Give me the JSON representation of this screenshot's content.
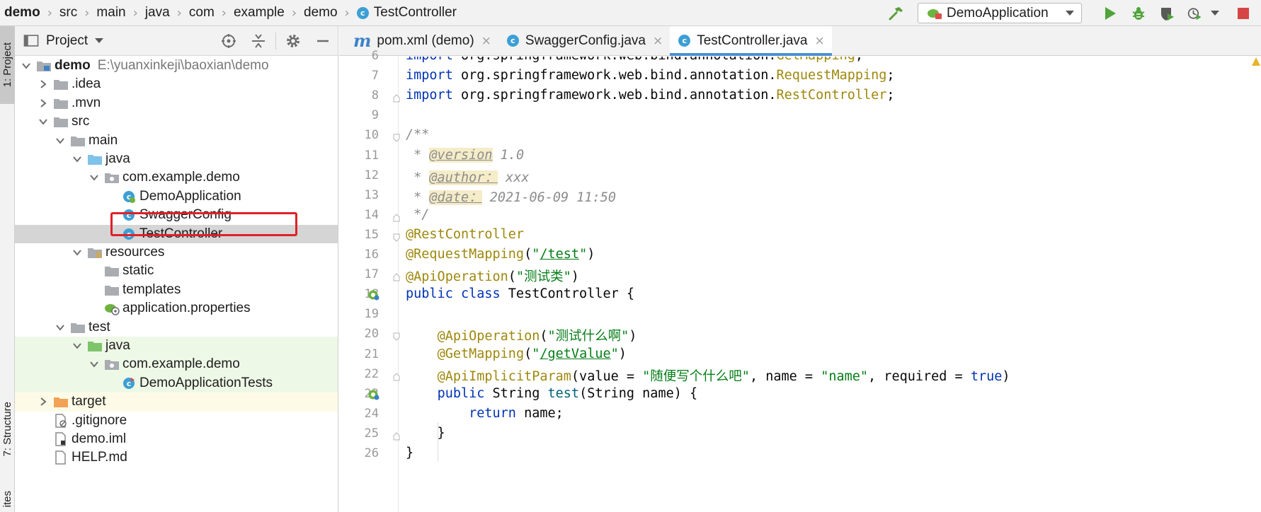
{
  "breadcrumb": [
    {
      "label": "demo",
      "bold": true
    },
    {
      "label": "src"
    },
    {
      "label": "main"
    },
    {
      "label": "java"
    },
    {
      "label": "com"
    },
    {
      "label": "example"
    },
    {
      "label": "demo"
    },
    {
      "label": "TestController",
      "class_icon": true
    }
  ],
  "toolbar": {
    "run_config": "DemoApplication",
    "icons": [
      "hammer-icon",
      "run-icon",
      "debug-icon",
      "coverage-icon",
      "profile-icon",
      "stop-icon"
    ]
  },
  "tool_strip": {
    "project_label": "1: Project",
    "structure_label": "7: Structure",
    "favorites_label": "ites"
  },
  "project_panel": {
    "title": "Project",
    "tree": [
      {
        "label": "demo",
        "path": "E:\\yuanxinkeji\\baoxian\\demo",
        "depth": 0,
        "chev": "down",
        "icon": "module"
      },
      {
        "label": ".idea",
        "depth": 1,
        "chev": "right",
        "icon": "folder"
      },
      {
        "label": ".mvn",
        "depth": 1,
        "chev": "right",
        "icon": "folder"
      },
      {
        "label": "src",
        "depth": 1,
        "chev": "down",
        "icon": "folder"
      },
      {
        "label": "main",
        "depth": 2,
        "chev": "down",
        "icon": "folder"
      },
      {
        "label": "java",
        "depth": 3,
        "chev": "down",
        "icon": "source-folder"
      },
      {
        "label": "com.example.demo",
        "depth": 4,
        "chev": "down",
        "icon": "package"
      },
      {
        "label": "DemoApplication",
        "depth": 5,
        "icon": "spring-class"
      },
      {
        "label": "SwaggerConfig",
        "depth": 5,
        "icon": "class"
      },
      {
        "label": "TestController",
        "depth": 5,
        "icon": "class",
        "selected": true
      },
      {
        "label": "resources",
        "depth": 3,
        "chev": "down",
        "icon": "resources-folder"
      },
      {
        "label": "static",
        "depth": 4,
        "icon": "folder"
      },
      {
        "label": "templates",
        "depth": 4,
        "icon": "folder"
      },
      {
        "label": "application.properties",
        "depth": 4,
        "icon": "properties"
      },
      {
        "label": "test",
        "depth": 2,
        "chev": "down",
        "icon": "folder"
      },
      {
        "label": "java",
        "depth": 3,
        "chev": "down",
        "icon": "test-folder",
        "test": true
      },
      {
        "label": "com.example.demo",
        "depth": 4,
        "chev": "down",
        "icon": "package",
        "test": true
      },
      {
        "label": "DemoApplicationTests",
        "depth": 5,
        "icon": "test-class",
        "test": true
      },
      {
        "label": "target",
        "depth": 1,
        "chev": "right",
        "icon": "excluded-folder",
        "excluded": true
      },
      {
        "label": ".gitignore",
        "depth": 1,
        "icon": "ignore-file"
      },
      {
        "label": "demo.iml",
        "depth": 1,
        "icon": "iml-file"
      },
      {
        "label": "HELP.md",
        "depth": 1,
        "icon": "md-file"
      }
    ]
  },
  "tabs": [
    {
      "label": "pom.xml (demo)",
      "icon": "maven",
      "active": false
    },
    {
      "label": "SwaggerConfig.java",
      "icon": "class",
      "active": false
    },
    {
      "label": "TestController.java",
      "icon": "class",
      "active": true
    }
  ],
  "code_lines": [
    {
      "n": "6",
      "html": "<span class=\"kw\">import</span> org.springframework.web.bind.annotation.<span class=\"ann\">GetMapping</span>;"
    },
    {
      "n": "7",
      "html": "<span class=\"kw\">import</span> org.springframework.web.bind.annotation.<span class=\"ann\">RequestMapping</span>;"
    },
    {
      "n": "8",
      "html": "<span class=\"kw\">import</span> org.springframework.web.bind.annotation.<span class=\"ann\">RestController</span>;"
    },
    {
      "n": "9",
      "html": ""
    },
    {
      "n": "10",
      "html": "<span class=\"cmt\">/**</span>"
    },
    {
      "n": "11",
      "html": "<span class=\"cmt\"> * </span><span class=\"tag\">@version</span><span class=\"cmt\"> 1.0</span>"
    },
    {
      "n": "12",
      "html": "<span class=\"cmt\"> * </span><span class=\"tag\">@author：</span><span class=\"cmt\"> xxx</span>"
    },
    {
      "n": "13",
      "html": "<span class=\"cmt\"> * </span><span class=\"tag\">@date：</span><span class=\"cmt\"> 2021-06-09 11:50</span>"
    },
    {
      "n": "14",
      "html": "<span class=\"cmt\"> */</span>"
    },
    {
      "n": "15",
      "html": "<span class=\"ann\">@RestController</span>"
    },
    {
      "n": "16",
      "html": "<span class=\"ann\">@RequestMapping</span>(<span class=\"str\">\"<span class=\"ul\">/test</span>\"</span>)"
    },
    {
      "n": "17",
      "html": "<span class=\"ann\">@ApiOperation</span>(<span class=\"str\">\"测试类\"</span>)"
    },
    {
      "n": "18",
      "html": "<span class=\"kw\">public class</span> TestController {"
    },
    {
      "n": "19",
      "html": ""
    },
    {
      "n": "20",
      "html": "    <span class=\"ann\">@ApiOperation</span>(<span class=\"str\">\"测试什么啊\"</span>)"
    },
    {
      "n": "21",
      "html": "    <span class=\"ann\">@GetMapping</span>(<span class=\"str\">\"<span class=\"ul\">/getValue</span>\"</span>)"
    },
    {
      "n": "22",
      "html": "    <span class=\"ann\">@ApiImplicitParam</span>(value = <span class=\"str\">\"随便写个什么吧\"</span>, name = <span class=\"str\">\"name\"</span>, required = <span class=\"kw\">true</span>)"
    },
    {
      "n": "23",
      "html": "    <span class=\"kw\">public</span> String <span class=\"fn\">test</span>(String name) {"
    },
    {
      "n": "24",
      "html": "        <span class=\"kw\">return</span> name;"
    },
    {
      "n": "25",
      "html": "    }"
    },
    {
      "n": "26",
      "html": "}"
    }
  ],
  "colors": {
    "accent": "#4a8fd6",
    "highlight_box": "#e0202a",
    "keyword": "#0033b3",
    "annotation": "#9e880d",
    "string": "#067d17"
  }
}
